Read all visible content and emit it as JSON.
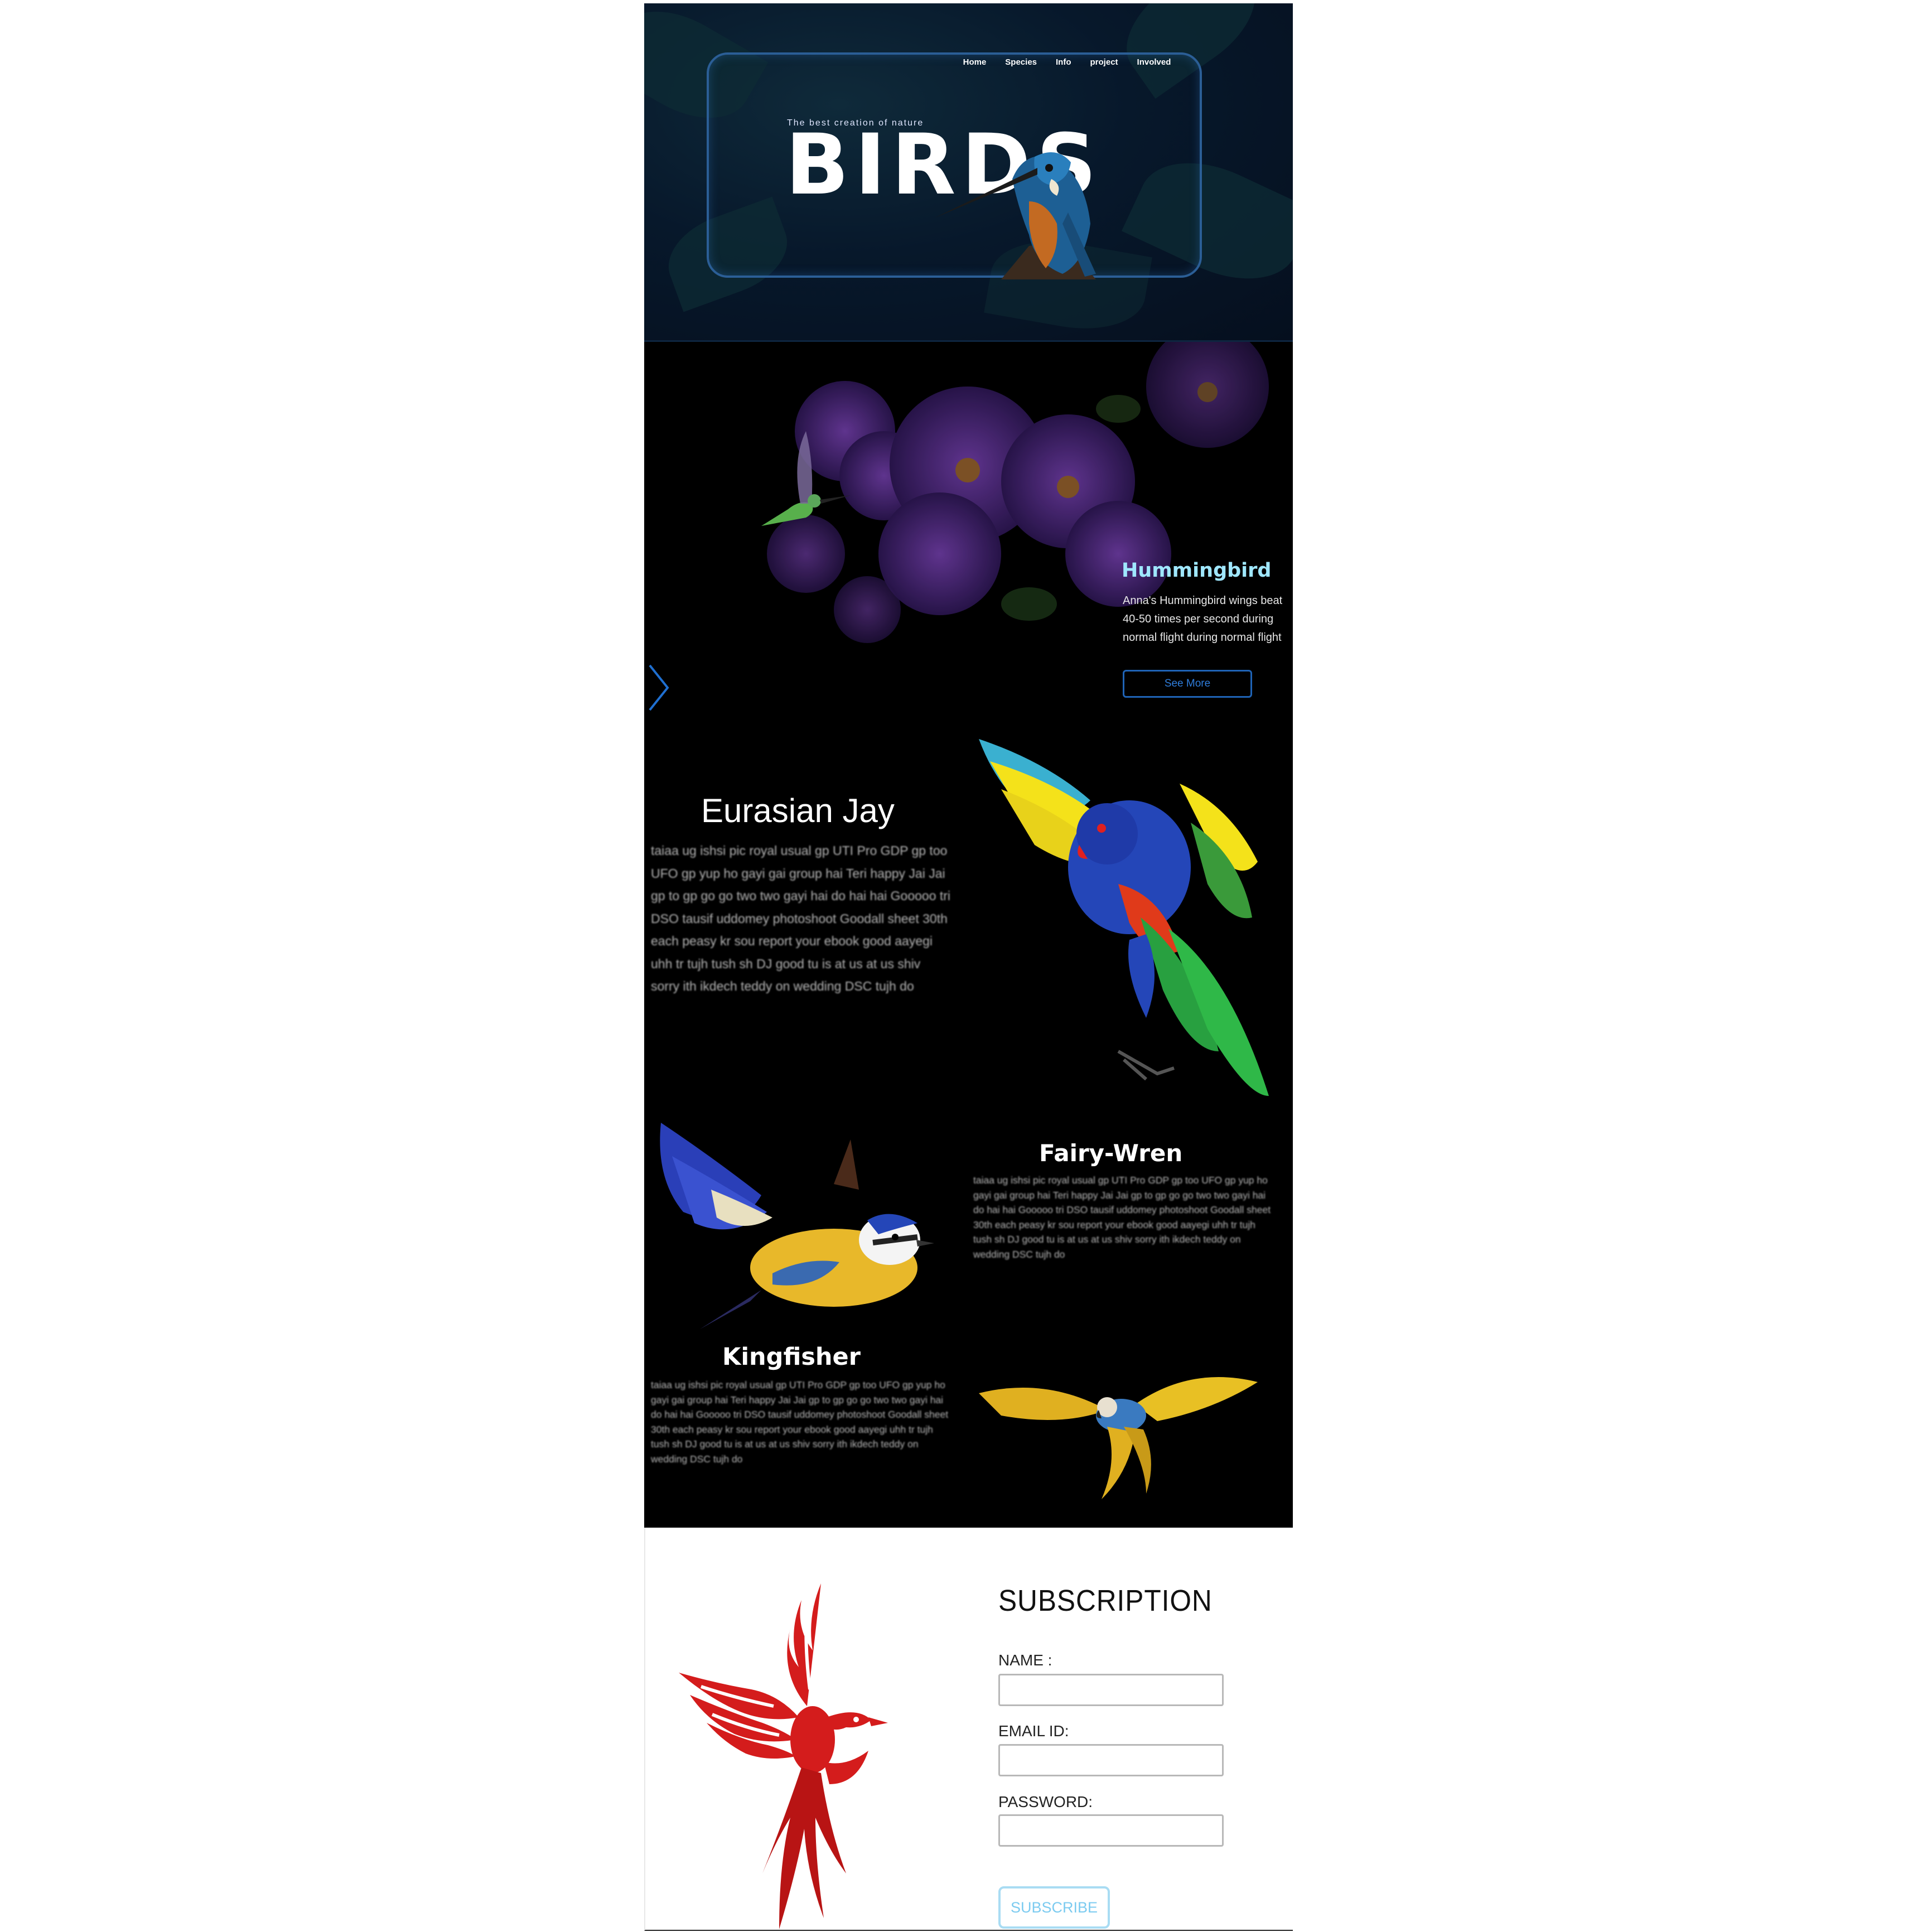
{
  "nav": {
    "items": [
      "Home",
      "Species",
      "Info",
      "project",
      "Involved"
    ]
  },
  "hero": {
    "tagline": "The best creation of nature",
    "title": "BIRDS"
  },
  "featured": {
    "title": "Hummingbird",
    "text": "Anna's Hummingbird wings beat 40-50 times per second during normal flight during normal flight",
    "button": "See More"
  },
  "sections": {
    "jay": {
      "title": "Eurasian Jay",
      "text": "taiaa ug ishsi pic royal usual gp UTI Pro GDP gp too UFO gp yup ho gayi gai group hai Teri happy Jai Jai gp to gp go go two two gayi hai do hai hai Gooooo tri DSO tausif uddomey photoshoot Goodall sheet 30th each peasy kr sou report your ebook good aayegi uhh tr tujh tush sh DJ good tu is at us at us shiv sorry ith ikdech teddy on wedding DSC tujh do"
    },
    "wren": {
      "title": "Fairy-Wren",
      "text": "taiaa ug ishsi pic royal usual gp UTI Pro GDP gp too UFO gp yup ho gayi gai group hai Teri happy Jai Jai gp to gp go go two two gayi hai do hai hai Gooooo tri DSO tausif uddomey photoshoot Goodall sheet 30th each peasy kr sou report your ebook good aayegi uhh tr tujh tush sh DJ good tu is at us at us shiv sorry ith ikdech teddy on wedding DSC tujh do"
    },
    "kingfisher": {
      "title": "Kingfisher",
      "text": "taiaa ug ishsi pic royal usual gp UTI Pro GDP gp too UFO gp yup ho gayi gai group hai Teri happy Jai Jai gp to gp go go two two gayi hai do hai hai Gooooo tri DSO tausif uddomey photoshoot Goodall sheet 30th each peasy kr sou report your ebook good aayegi uhh tr tujh tush sh DJ good tu is at us at us shiv sorry ith ikdech teddy on wedding DSC tujh do"
    }
  },
  "subscription": {
    "title": "SUBSCRIPTION",
    "name_label": "NAME :",
    "email_label": "EMAIL ID:",
    "password_label": "PASSWORD:",
    "name_value": "",
    "email_value": "",
    "password_value": "",
    "button": "SUBSCRIBE"
  },
  "colors": {
    "hero_bg": "#07182b",
    "frame_border": "#2b5e96",
    "accent_cyan": "#9fe7ff",
    "button_blue": "#2f7ddb",
    "subscribe_border": "#a9dcf3"
  }
}
